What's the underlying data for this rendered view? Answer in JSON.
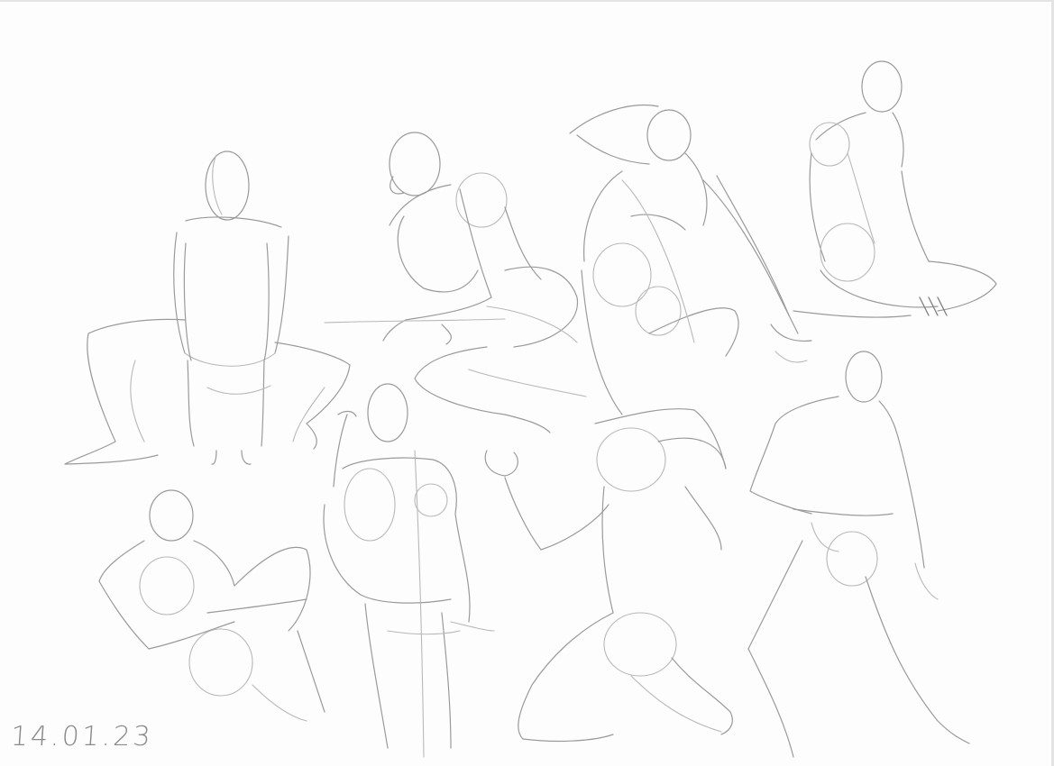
{
  "sheet": {
    "date": "14.01.23",
    "paper_color": "#fdfdfd",
    "pencil_color": "#9a9a9a"
  }
}
